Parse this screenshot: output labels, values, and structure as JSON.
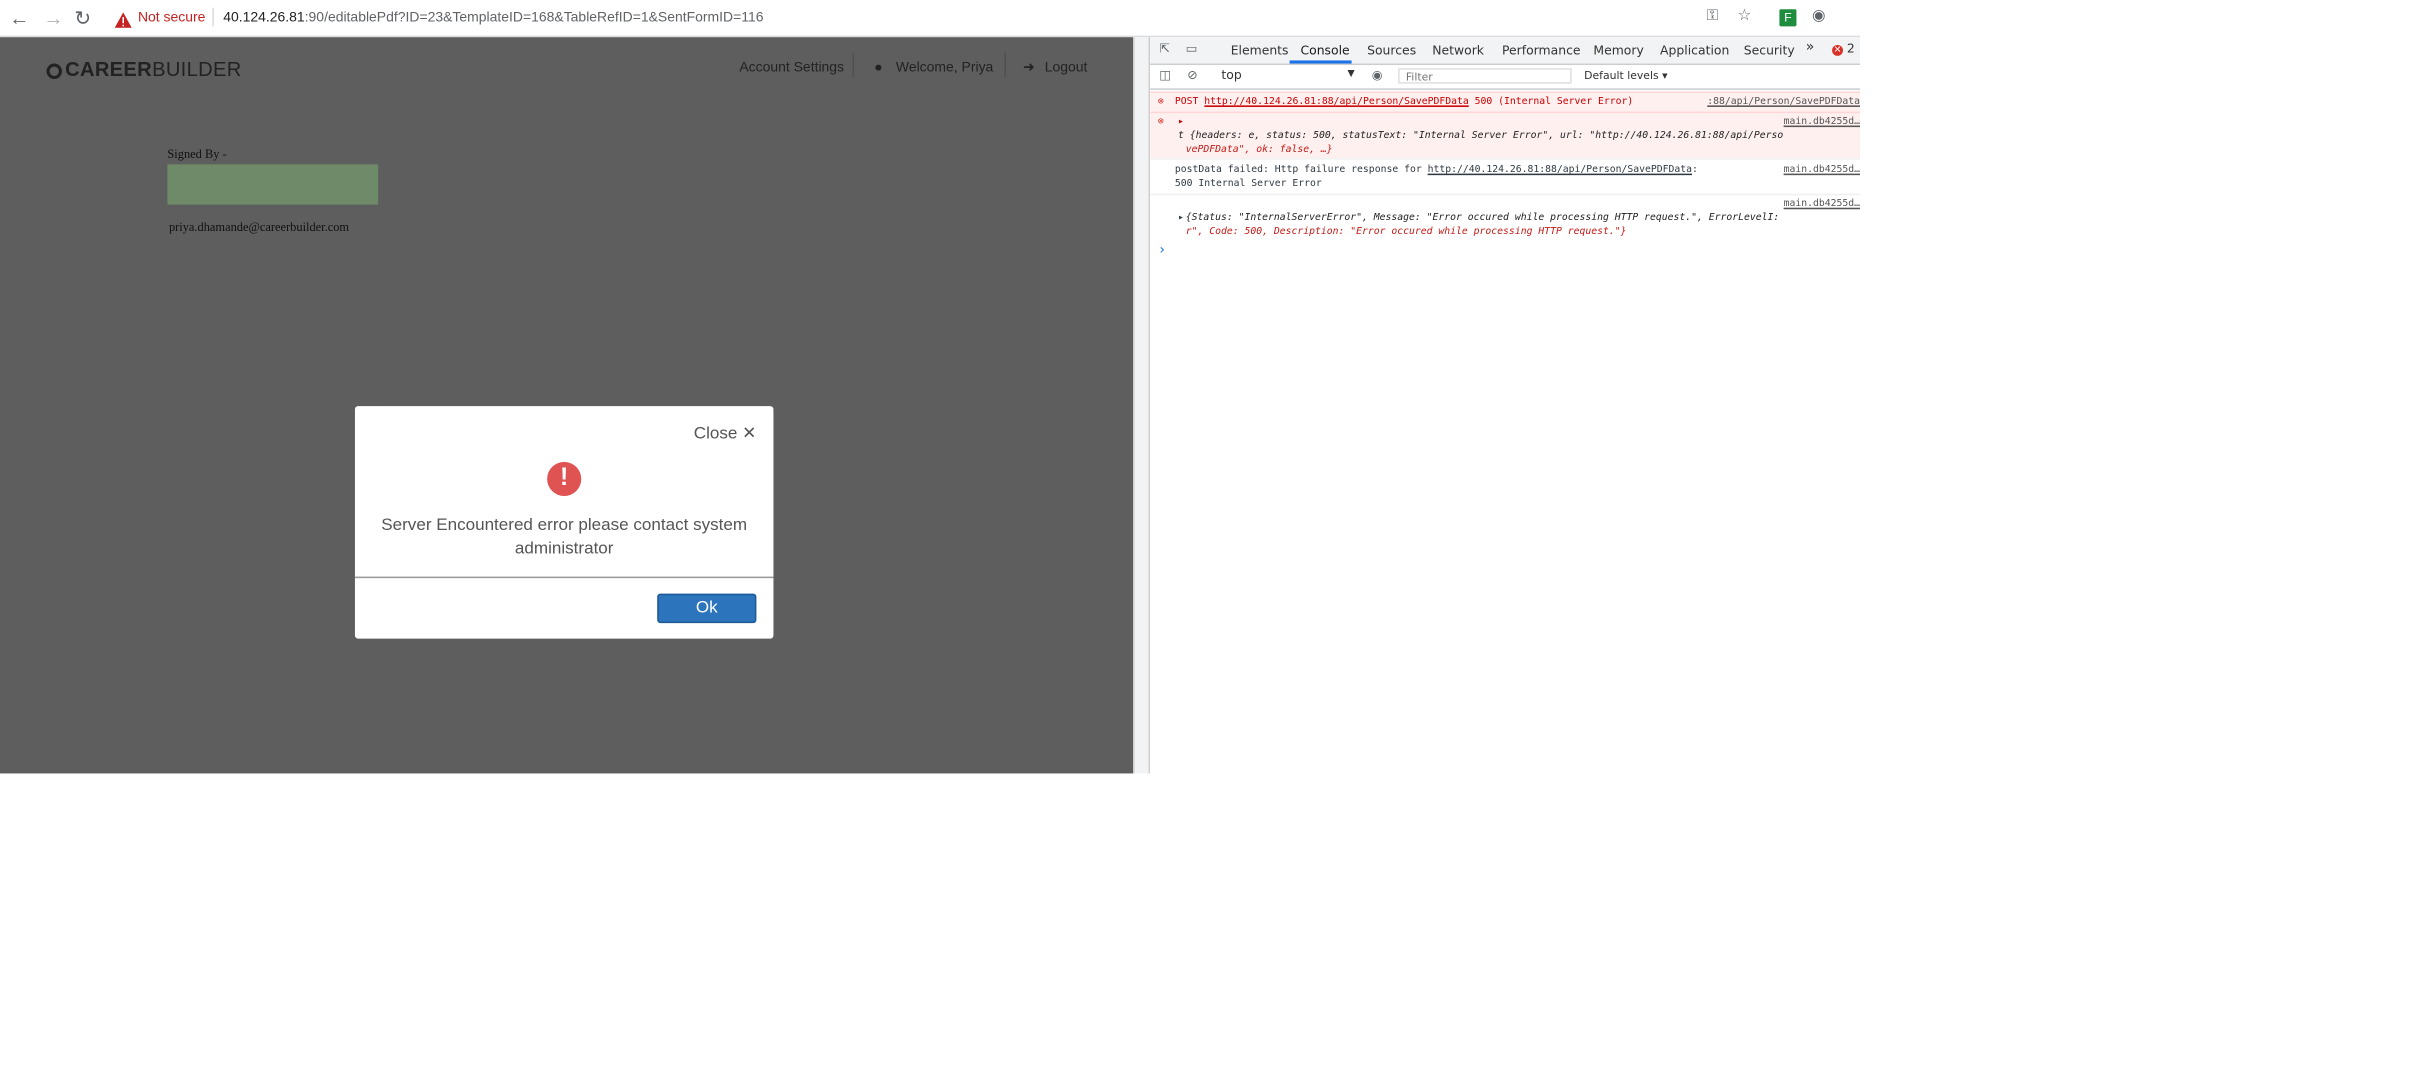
{
  "browser": {
    "not_secure": "Not secure",
    "url_host": "40.124.26.81",
    "url_rest": ":90/editablePdf?ID=23&TemplateID=168&TableRefID=1&SentFormID=116"
  },
  "app": {
    "logo_bold": "CAREER",
    "logo_light": "BUILDER",
    "nav": {
      "account_settings": "Account Settings",
      "welcome": "Welcome, Priya",
      "logout": "Logout"
    },
    "signed_by": "Signed By -",
    "email": "priya.dhamande@careerbuilder.com"
  },
  "modal": {
    "close_label": "Close",
    "message_line1": "Server Encountered error please contact system",
    "message_line2": "administrator",
    "ok_label": "Ok"
  },
  "devtools": {
    "tabs": [
      "Elements",
      "Console",
      "Sources",
      "Network",
      "Performance",
      "Memory",
      "Application",
      "Security"
    ],
    "active_tab": "Console",
    "more": "»",
    "error_count": "2",
    "context": "top",
    "filter_placeholder": "Filter",
    "levels": "Default levels",
    "log": {
      "l1_method": "POST",
      "l1_url": "http://40.124.26.81:88/api/Person/SavePDFData",
      "l1_status": "500 (Internal Server Error)",
      "l1_src": ":88/api/Person/SavePDFData",
      "l2_src": "main.db4255d…",
      "l2_line1": "t {headers: e, status: 500, statusText: \"Internal Server Error\", url: \"http://40.124.26.81:88/api/Perso",
      "l2_line2": "vePDFData\", ok: false, …}",
      "l3_prefix": "postData failed: Http failure response for",
      "l3_url": "http://40.124.26.81:88/api/Person/SavePDFData",
      "l3_suffix": ":",
      "l3_line2": "500 Internal Server Error",
      "l3_src": "main.db4255d…",
      "l4_src": "main.db4255d…",
      "l4_line1": "{Status: \"InternalServerError\", Message: \"Error occured while processing HTTP request.\", ErrorLevelI:",
      "l4_line2": "r\", Code: 500, Description: \"Error occured while processing HTTP request.\"}"
    }
  }
}
